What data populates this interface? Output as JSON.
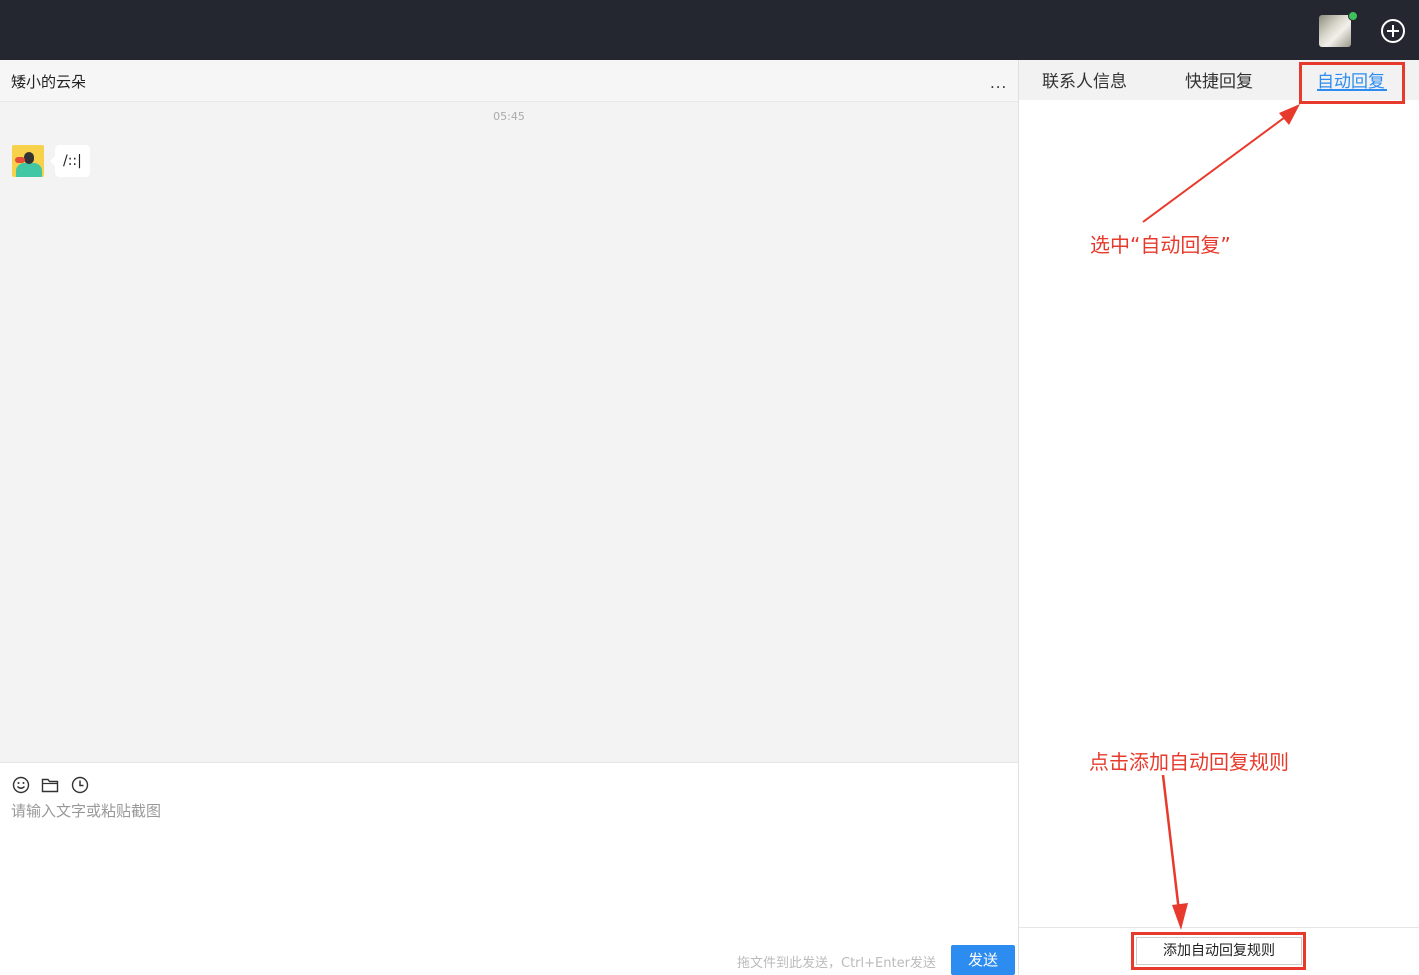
{
  "topbar": {
    "user_avatar": "user-avatar",
    "status": "online",
    "add_icon": "plus-circle-icon"
  },
  "chat": {
    "title": "矮小的云朵",
    "more": "...",
    "timestamp": "05:45",
    "messages": [
      {
        "from": "contact",
        "text": "/::|"
      }
    ],
    "input_placeholder": "请输入文字或粘贴截图",
    "hint": "拖文件到此发送，Ctrl+Enter发送",
    "send_label": "发送",
    "tools": [
      "smiley-icon",
      "folder-icon",
      "clock-icon"
    ]
  },
  "side_panel": {
    "tabs": [
      {
        "label": "联系人信息",
        "active": false
      },
      {
        "label": "快捷回复",
        "active": false
      },
      {
        "label": "自动回复",
        "active": true
      }
    ],
    "add_rule_label": "添加自动回复规则"
  },
  "annotations": {
    "select_tab": "选中“自动回复”",
    "click_add": "点击添加自动回复规则"
  },
  "colors": {
    "accent": "#2d8cf0",
    "topbar": "#242630",
    "annotation": "#e83a2c"
  }
}
